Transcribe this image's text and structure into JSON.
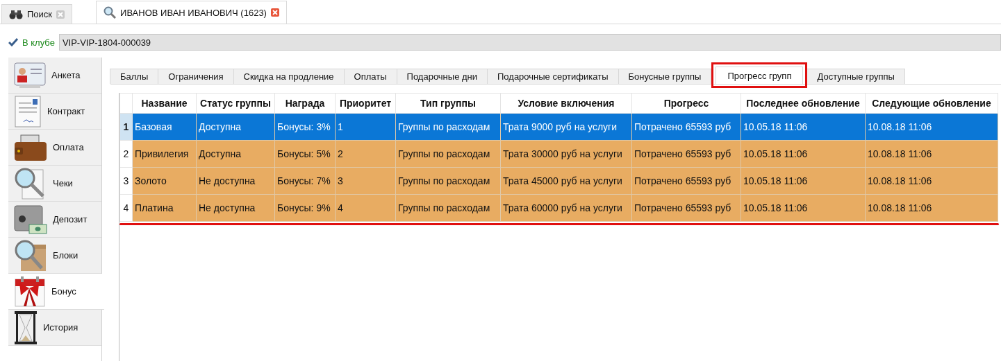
{
  "doc_tabs": [
    {
      "label": "Поиск",
      "selected": false
    },
    {
      "label": "ИВАНОВ ИВАН ИВАНОВИЧ (1623)",
      "selected": true
    }
  ],
  "club": {
    "label": "В клубе",
    "value": "VIP-VIP-1804-000039"
  },
  "sidebar": {
    "items": [
      {
        "label": "Анкета",
        "selected": false
      },
      {
        "label": "Контракт",
        "selected": false
      },
      {
        "label": "Оплата",
        "selected": false
      },
      {
        "label": "Чеки",
        "selected": false
      },
      {
        "label": "Депозит",
        "selected": false
      },
      {
        "label": "Блоки",
        "selected": false
      },
      {
        "label": "Бонус",
        "selected": true
      },
      {
        "label": "История",
        "selected": false
      }
    ]
  },
  "tabs": [
    {
      "label": "Баллы",
      "selected": false,
      "highlighted": false
    },
    {
      "label": "Ограничения",
      "selected": false,
      "highlighted": false
    },
    {
      "label": "Скидка на продление",
      "selected": false,
      "highlighted": false
    },
    {
      "label": "Оплаты",
      "selected": false,
      "highlighted": false
    },
    {
      "label": "Подарочные дни",
      "selected": false,
      "highlighted": false
    },
    {
      "label": "Подарочные сертификаты",
      "selected": false,
      "highlighted": false
    },
    {
      "label": "Бонусные группы",
      "selected": false,
      "highlighted": false
    },
    {
      "label": "Прогресс групп",
      "selected": true,
      "highlighted": true
    },
    {
      "label": "Доступные группы",
      "selected": false,
      "highlighted": false
    }
  ],
  "table": {
    "underlined": true,
    "columns": [
      "Название",
      "Статус группы",
      "Награда",
      "Приоритет",
      "Тип группы",
      "Условие включения",
      "Прогресс",
      "Последнее обновление",
      "Следующие обновление"
    ],
    "rows": [
      {
        "number": "1",
        "selected": true,
        "cells": [
          "Базовая",
          "Доступна",
          "Бонусы: 3%",
          "1",
          "Группы по расходам",
          "Трата 9000 руб на услуги",
          "Потрачено 65593 руб",
          "10.05.18 11:06",
          "10.08.18 11:06"
        ]
      },
      {
        "number": "2",
        "selected": false,
        "cells": [
          "Привилегия",
          "Доступна",
          "Бонусы: 5%",
          "2",
          "Группы по расходам",
          "Трата 30000 руб на услуги",
          "Потрачено 65593 руб",
          "10.05.18 11:06",
          "10.08.18 11:06"
        ]
      },
      {
        "number": "3",
        "selected": false,
        "cells": [
          "Золото",
          "Не доступна",
          "Бонусы: 7%",
          "3",
          "Группы по расходам",
          "Трата 45000 руб на услуги",
          "Потрачено 65593 руб",
          "10.05.18 11:06",
          "10.08.18 11:06"
        ]
      },
      {
        "number": "4",
        "selected": false,
        "cells": [
          "Платина",
          "Не доступна",
          "Бонусы: 9%",
          "4",
          "Группы по расходам",
          "Трата 60000 руб на услуги",
          "Потрачено 65593 руб",
          "10.05.18 11:06",
          "10.08.18 11:06"
        ]
      }
    ]
  }
}
